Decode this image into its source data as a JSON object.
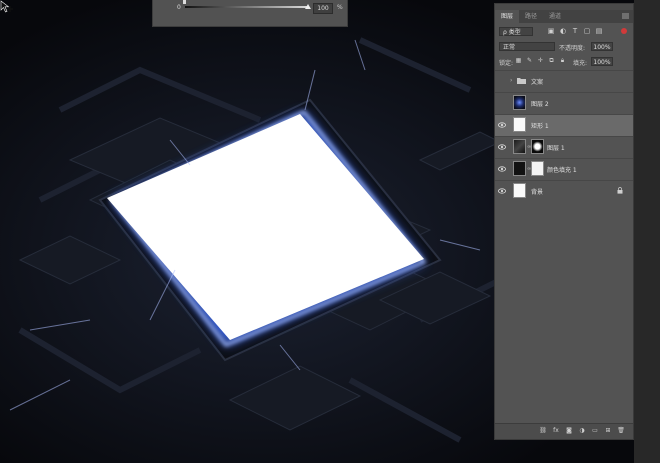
{
  "colors": {
    "canvas_bg": "#0a0c12",
    "glow": "#3b6cff",
    "panel_bg": "#535353",
    "selected_row": "#6a6a6a",
    "filter_toggle": "#d03a3a"
  },
  "levels_dialog": {
    "min_value": "0",
    "max_value": "100",
    "unit": "%"
  },
  "panel": {
    "tabs": [
      {
        "label": "图层",
        "active": true
      },
      {
        "label": "路径",
        "active": false
      },
      {
        "label": "通道",
        "active": false
      }
    ],
    "filter_kind": "ρ 类型",
    "filter_icons": [
      "image-filter-icon",
      "adjustment-filter-icon",
      "type-filter-icon",
      "shape-filter-icon",
      "smart-object-filter-icon"
    ],
    "blend_mode": "正常",
    "opacity_label": "不透明度:",
    "opacity_value": "100%",
    "lock_label": "锁定:",
    "fill_label": "填充:",
    "fill_value": "100%",
    "layers": [
      {
        "name": "文案",
        "type": "group",
        "visible": false
      },
      {
        "name": "图层 2",
        "type": "image",
        "visible": false
      },
      {
        "name": "矩形 1",
        "type": "shape",
        "visible": true,
        "selected": true
      },
      {
        "name": "图层 1",
        "type": "image-with-mask",
        "visible": true
      },
      {
        "name": "颜色填充 1",
        "type": "fill",
        "visible": true
      },
      {
        "name": "背景",
        "type": "background",
        "visible": true,
        "locked": true
      }
    ],
    "bottom_icons": [
      "link-layers-icon",
      "fx-icon",
      "add-mask-icon",
      "adjustment-layer-icon",
      "new-group-icon",
      "new-layer-icon",
      "delete-layer-icon"
    ]
  }
}
